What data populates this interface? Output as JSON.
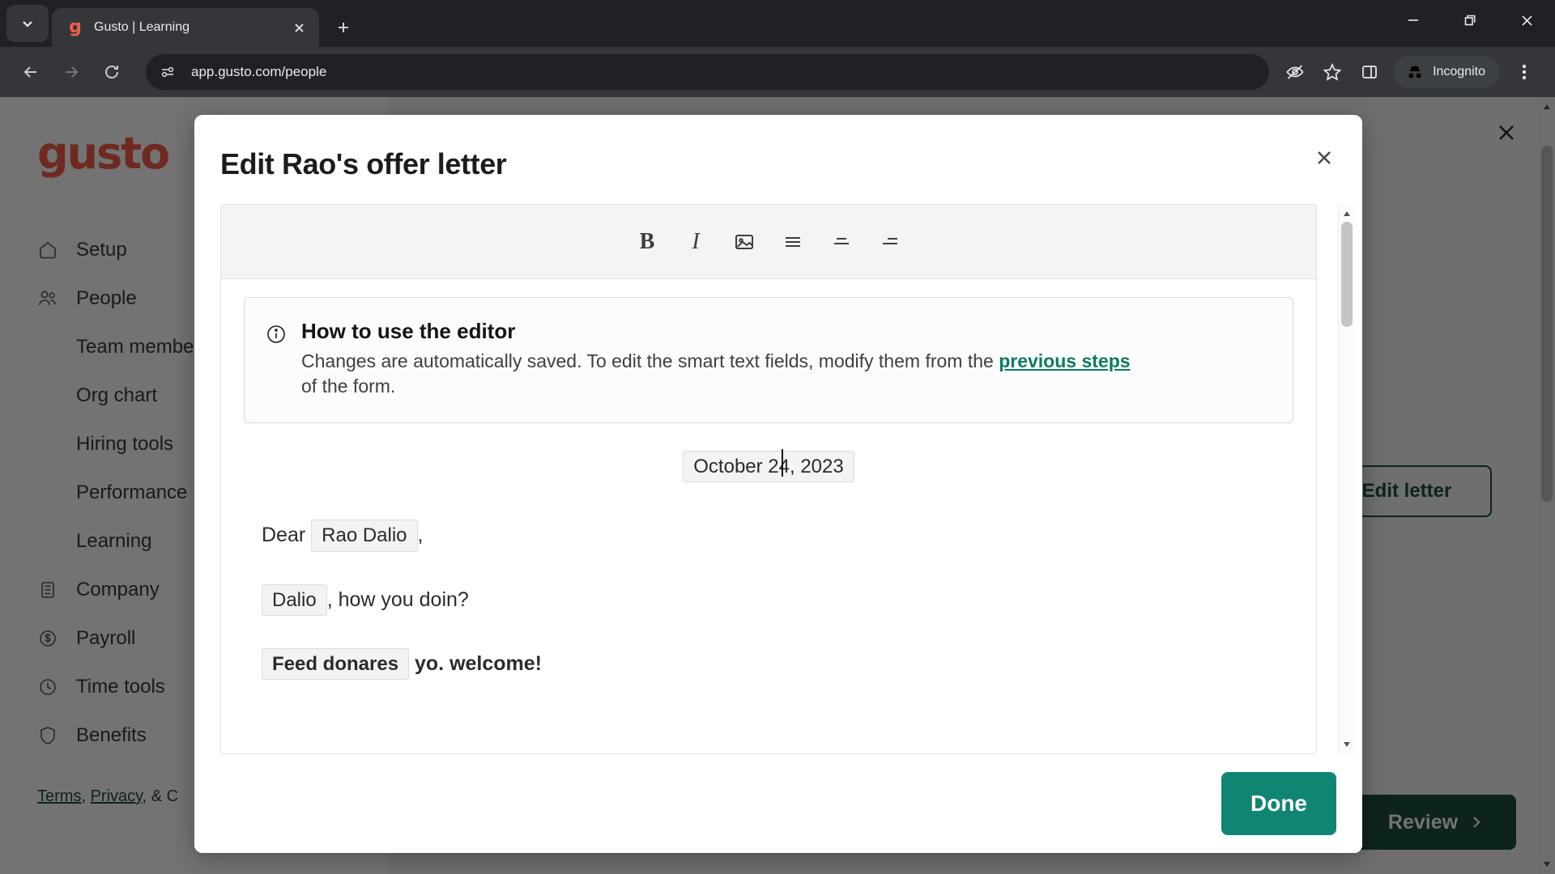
{
  "browser": {
    "tab": {
      "favicon_letter": "g",
      "title": "Gusto | Learning"
    },
    "url": "app.gusto.com/people",
    "profile_label": "Incognito",
    "icons": {
      "tab_search": "chevron-down-icon",
      "tab_close": "close-icon",
      "new_tab": "plus-icon",
      "back": "back-arrow-icon",
      "forward": "forward-arrow-icon",
      "reload": "reload-icon",
      "site_info": "site-settings-icon",
      "tracking": "eye-slash-icon",
      "bookmark": "star-icon",
      "side_panel": "side-panel-icon",
      "incognito": "incognito-hat-icon",
      "menu": "three-dot-menu-icon",
      "minimize": "minimize-icon",
      "maximize": "restore-window-icon",
      "close": "window-close-icon"
    }
  },
  "app": {
    "logo": "gusto",
    "nav": [
      {
        "label": "Setup",
        "icon": "home-icon",
        "sub": []
      },
      {
        "label": "People",
        "icon": "people-icon",
        "sub": [
          "Team members",
          "Org chart",
          "Hiring tools",
          "Performance",
          "Learning"
        ]
      },
      {
        "label": "Company",
        "icon": "building-icon",
        "sub": []
      },
      {
        "label": "Payroll",
        "icon": "dollar-circle-icon",
        "sub": []
      },
      {
        "label": "Time tools",
        "icon": "clock-icon",
        "sub": []
      },
      {
        "label": "Benefits",
        "icon": "shield-icon",
        "sub": []
      }
    ],
    "legal": {
      "terms": "Terms",
      "privacy": "Privacy",
      "connector": ", ",
      "trailing": ", & C"
    },
    "edit_letter_button": "Edit letter",
    "review_button": "Review",
    "close_icon": "close-icon"
  },
  "modal": {
    "title": "Edit Rao's offer letter",
    "close_icon": "close-icon",
    "toolbar": [
      {
        "name": "bold-icon",
        "glyph": "B"
      },
      {
        "name": "italic-icon",
        "glyph": "I"
      },
      {
        "name": "image-icon",
        "glyph": ""
      },
      {
        "name": "align-left-icon",
        "glyph": ""
      },
      {
        "name": "align-center-icon",
        "glyph": ""
      },
      {
        "name": "align-right-icon",
        "glyph": ""
      }
    ],
    "info": {
      "icon": "info-circle-icon",
      "title": "How to use the editor",
      "text_before": "Changes are automatically saved. To edit the smart text fields, modify them from the ",
      "link": "previous steps",
      "text_after": " of the form."
    },
    "letter": {
      "date": "October 24, 2023",
      "salutation_prefix": "Dear",
      "salutation_chip": "Rao Dalio",
      "salutation_suffix": ",",
      "line2_chip": "Dalio",
      "line2_text": ", how you doin?",
      "line3_chip": "Feed donares",
      "line3_text": "yo. welcome!"
    },
    "done_button": "Done"
  },
  "colors": {
    "brand_coral": "#f45d48",
    "gusto_green": "#1d4f43",
    "teal_accent": "#108672",
    "link_green": "#0d7a62",
    "chrome_dark": "#202124",
    "chrome_toolbar": "#35363a"
  }
}
